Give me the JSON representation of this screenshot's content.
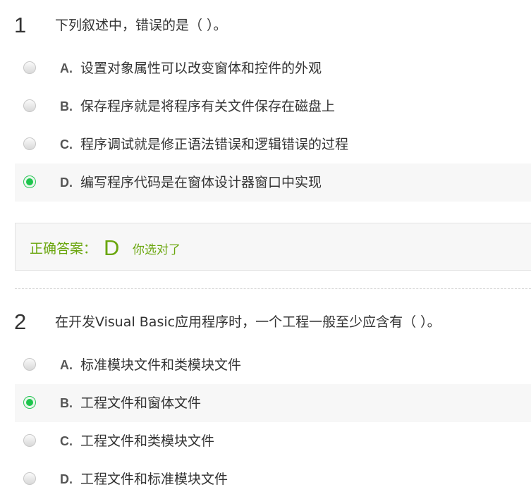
{
  "questions": [
    {
      "number": "1",
      "text": "下列叙述中，错误的是（ ）。",
      "options": [
        {
          "letter": "A.",
          "text": "设置对象属性可以改变窗体和控件的外观",
          "selected": false
        },
        {
          "letter": "B.",
          "text": "保存程序就是将程序有关文件保存在磁盘上",
          "selected": false
        },
        {
          "letter": "C.",
          "text": "程序调试就是修正语法错误和逻辑错误的过程",
          "selected": false
        },
        {
          "letter": "D.",
          "text": "编写程序代码是在窗体设计器窗口中实现",
          "selected": true
        }
      ],
      "answer": {
        "label": "正确答案：",
        "letter": "D",
        "note": "你选对了"
      }
    },
    {
      "number": "2",
      "text": "在开发Visual Basic应用程序时，一个工程一般至少应含有（ ）。",
      "options": [
        {
          "letter": "A.",
          "text": "标准模块文件和类模块文件",
          "selected": false
        },
        {
          "letter": "B.",
          "text": "工程文件和窗体文件",
          "selected": true
        },
        {
          "letter": "C.",
          "text": "工程文件和类模块文件",
          "selected": false
        },
        {
          "letter": "D.",
          "text": "工程文件和标准模块文件",
          "selected": false
        }
      ]
    }
  ],
  "colors": {
    "correct_text": "#6aa60d",
    "radio_checked": "#1dc44c",
    "selected_row_bg": "#f7f7f7"
  }
}
